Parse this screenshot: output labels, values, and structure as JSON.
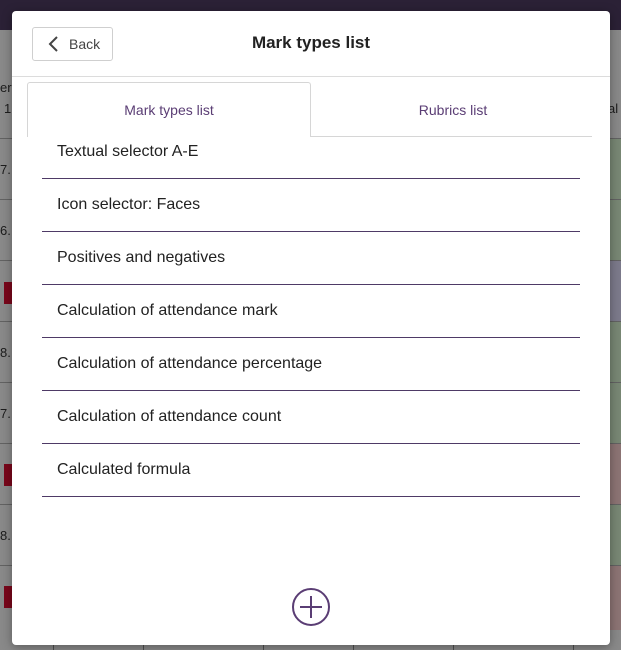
{
  "background": {
    "fragments": [
      "ere",
      "1",
      "7.",
      "6.",
      "8.",
      "7.",
      "8.",
      "al"
    ]
  },
  "modal": {
    "title": "Mark types list",
    "back_label": "Back",
    "back_icon": "chevron-left-icon",
    "add_icon": "plus-circle-icon",
    "accent_color": "#5a3d74"
  },
  "tabs": [
    {
      "label": "Mark types list",
      "active": true
    },
    {
      "label": "Rubrics list",
      "active": false
    }
  ],
  "mark_types": [
    {
      "label": "Textual selector A-E"
    },
    {
      "label": "Icon selector: Faces"
    },
    {
      "label": "Positives and negatives"
    },
    {
      "label": "Calculation of attendance mark"
    },
    {
      "label": "Calculation of attendance percentage"
    },
    {
      "label": "Calculation of attendance count"
    },
    {
      "label": "Calculated formula"
    }
  ]
}
